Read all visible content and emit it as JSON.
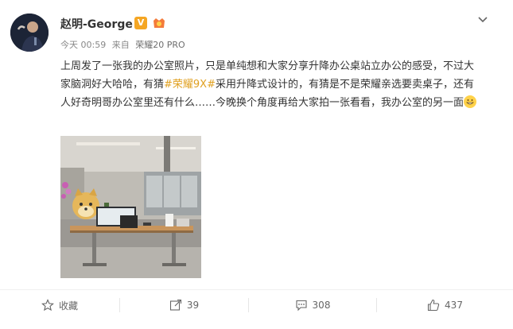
{
  "post": {
    "username": "赵明-George",
    "verified_badge": "V",
    "meta": {
      "time": "今天 00:59",
      "from_label": "来自",
      "device": "荣耀20 PRO"
    },
    "text_part1": "上周发了一张我的办公室照片，只是单纯想和大家分享升降办公桌站立办公的感受，不过大家脑洞好大哈哈，有猜",
    "topic": "#荣耀9X#",
    "text_part2": "采用升降式设计的，有猜是不是荣耀亲选要卖桌子，还有人好奇明哥办公室里还有什么……今晚换个角度再给大家拍一张看看，我办公室的另一面",
    "image_alt": "office photo"
  },
  "footer": {
    "favorite_label": "收藏",
    "repost_count": "39",
    "comment_count": "308",
    "like_count": "437"
  },
  "icons": {
    "chevron": "chevron-down-icon",
    "favorite": "star-icon",
    "repost": "share-icon",
    "comment": "comment-icon",
    "like": "thumbs-up-icon"
  }
}
